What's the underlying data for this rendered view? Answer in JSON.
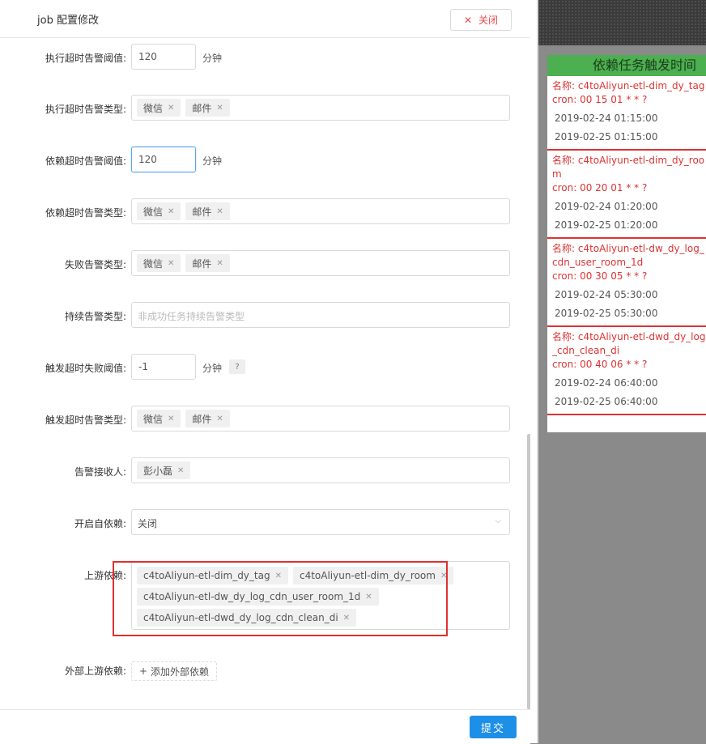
{
  "modal": {
    "title": "job 配置修改",
    "close_label": "关闭",
    "submit_label": "提交"
  },
  "form": {
    "exec_timeout_threshold": {
      "label": "执行超时告警阈值:",
      "value": "120",
      "unit": "分钟"
    },
    "exec_timeout_types": {
      "label": "执行超时告警类型:",
      "tags": [
        "微信",
        "邮件"
      ]
    },
    "dep_timeout_threshold": {
      "label": "依赖超时告警阈值:",
      "value": "120",
      "unit": "分钟"
    },
    "dep_timeout_types": {
      "label": "依赖超时告警类型:",
      "tags": [
        "微信",
        "邮件"
      ]
    },
    "fail_types": {
      "label": "失败告警类型:",
      "tags": [
        "微信",
        "邮件"
      ]
    },
    "persist_types": {
      "label": "持续告警类型:",
      "placeholder": "非成功任务持续告警类型"
    },
    "trigger_fail_threshold": {
      "label": "触发超时失败阈值:",
      "value": "-1",
      "unit": "分钟",
      "help": "?"
    },
    "trigger_timeout_types": {
      "label": "触发超时告警类型:",
      "tags": [
        "微信",
        "邮件"
      ]
    },
    "receivers": {
      "label": "告警接收人:",
      "tags": [
        "彭小磊"
      ]
    },
    "self_dep": {
      "label": "开启自依赖:",
      "value": "关闭"
    },
    "upstream": {
      "label": "上游依赖:",
      "tags": [
        "c4toAliyun-etl-dim_dy_tag",
        "c4toAliyun-etl-dim_dy_room",
        "c4toAliyun-etl-dw_dy_log_cdn_user_room_1d",
        "c4toAliyun-etl-dwd_dy_log_cdn_clean_di"
      ]
    },
    "external_upstream": {
      "label": "外部上游依赖:",
      "add_label": "添加外部依赖"
    }
  },
  "trigger_panel": {
    "title": "依赖任务触发时间",
    "entries": [
      {
        "name": "名称: c4toAliyun-etl-dim_dy_tag",
        "cron": "cron: 00 15 01 * * ?",
        "times": [
          "2019-02-24 01:15:00",
          "2019-02-25 01:15:00"
        ]
      },
      {
        "name": "名称: c4toAliyun-etl-dim_dy_room",
        "cron": "cron: 00 20 01 * * ?",
        "times": [
          "2019-02-24 01:20:00",
          "2019-02-25 01:20:00"
        ]
      },
      {
        "name": "名称: c4toAliyun-etl-dw_dy_log_cdn_user_room_1d",
        "cron": "cron: 00 30 05 * * ?",
        "times": [
          "2019-02-24 05:30:00",
          "2019-02-25 05:30:00"
        ]
      },
      {
        "name": "名称: c4toAliyun-etl-dwd_dy_log_cdn_clean_di",
        "cron": "cron: 00 40 06 * * ?",
        "times": [
          "2019-02-24 06:40:00",
          "2019-02-25 06:40:00"
        ]
      }
    ]
  },
  "colors": {
    "accent": "#1e8fe6",
    "alert_red": "#dd3333",
    "panel_green": "#4caf50"
  }
}
